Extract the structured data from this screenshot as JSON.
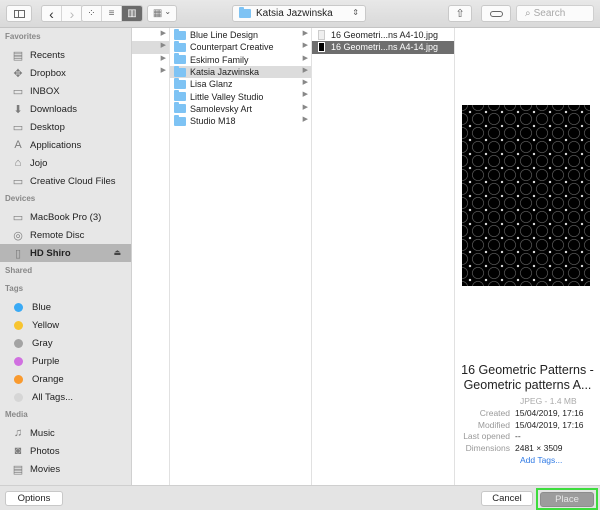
{
  "toolbar": {
    "sidebar_toggle_icon": "sidebar-icon",
    "back_icon": "‹",
    "forward_icon": "›",
    "views": [
      {
        "name": "icon-view",
        "glyph": "⁘",
        "active": false
      },
      {
        "name": "list-view",
        "glyph": "≡",
        "active": false
      },
      {
        "name": "column-view",
        "glyph": "▥",
        "active": true
      }
    ],
    "arrange_glyph": "▦",
    "arrange_chevron": "⌄",
    "path_label": "Katsia Jazwinska",
    "path_chevron": "⌃⌄",
    "share_glyph": "⇧",
    "tag_glyph": "⬭",
    "search_placeholder": "Search",
    "search_glyph": "⚲"
  },
  "sidebar": {
    "sections": [
      {
        "title": "Favorites",
        "items": [
          {
            "label": "Recents",
            "icon": "recents-icon",
            "glyph": "▤"
          },
          {
            "label": "Dropbox",
            "icon": "dropbox-icon",
            "glyph": "✥"
          },
          {
            "label": "INBOX",
            "icon": "folder-icon",
            "glyph": "▭"
          },
          {
            "label": "Downloads",
            "icon": "downloads-icon",
            "glyph": "⬇"
          },
          {
            "label": "Desktop",
            "icon": "desktop-icon",
            "glyph": "▭"
          },
          {
            "label": "Applications",
            "icon": "applications-icon",
            "glyph": "A"
          },
          {
            "label": "Jojo",
            "icon": "home-icon",
            "glyph": "⌂"
          },
          {
            "label": "Creative Cloud Files",
            "icon": "folder-icon",
            "glyph": "▭"
          }
        ]
      },
      {
        "title": "Devices",
        "items": [
          {
            "label": "MacBook Pro (3)",
            "icon": "laptop-icon",
            "glyph": "▭"
          },
          {
            "label": "Remote Disc",
            "icon": "disc-icon",
            "glyph": "◎"
          },
          {
            "label": "HD Shiro",
            "icon": "hard-drive-icon",
            "glyph": "▯",
            "selected": true,
            "eject": "⏏"
          }
        ]
      },
      {
        "title": "Shared",
        "items": []
      },
      {
        "title": "Tags",
        "items": [
          {
            "label": "Blue",
            "color": "#3aaaf5"
          },
          {
            "label": "Yellow",
            "color": "#f7c430"
          },
          {
            "label": "Gray",
            "color": "#a3a3a3"
          },
          {
            "label": "Purple",
            "color": "#d070e0"
          },
          {
            "label": "Orange",
            "color": "#f99a2e"
          },
          {
            "label": "All Tags...",
            "color": "#d6d6d6"
          }
        ]
      },
      {
        "title": "Media",
        "items": [
          {
            "label": "Music",
            "icon": "music-icon",
            "glyph": "♫"
          },
          {
            "label": "Photos",
            "icon": "camera-icon",
            "glyph": "◙"
          },
          {
            "label": "Movies",
            "icon": "film-icon",
            "glyph": "▤"
          }
        ]
      }
    ]
  },
  "columns": {
    "col1": {
      "rows": [
        {
          "state": "none"
        },
        {
          "state": "gray"
        },
        {
          "state": "none"
        },
        {
          "state": "none"
        }
      ]
    },
    "col2": {
      "folders": [
        {
          "label": "Blue Line Design",
          "state": "none"
        },
        {
          "label": "Counterpart Creative",
          "state": "none"
        },
        {
          "label": "Eskimo Family",
          "state": "none"
        },
        {
          "label": "Katsia Jazwinska",
          "state": "gray"
        },
        {
          "label": "Lisa Glanz",
          "state": "none"
        },
        {
          "label": "Little Valley Studio",
          "state": "none"
        },
        {
          "label": "Samolevsky Art",
          "state": "none"
        },
        {
          "label": "Studio M18",
          "state": "none"
        }
      ]
    },
    "col3": {
      "files": [
        {
          "label": "16 Geometri...ns A4-10.jpg",
          "thumb": "white",
          "state": "none"
        },
        {
          "label": "16 Geometri...ns A4-14.jpg",
          "thumb": "black",
          "state": "dark"
        }
      ]
    }
  },
  "preview": {
    "title": "16 Geometric Patterns - Geometric patterns A...",
    "kind": "JPEG - 1.4 MB",
    "meta": [
      {
        "key": "Created",
        "value": "15/04/2019, 17:16"
      },
      {
        "key": "Modified",
        "value": "15/04/2019, 17:16"
      },
      {
        "key": "Last opened",
        "value": "--"
      },
      {
        "key": "Dimensions",
        "value": "2481 × 3509"
      }
    ],
    "add_tags": "Add Tags..."
  },
  "bottom": {
    "options": "Options",
    "cancel": "Cancel",
    "place": "Place",
    "highlight_color": "#3ddc3d"
  }
}
